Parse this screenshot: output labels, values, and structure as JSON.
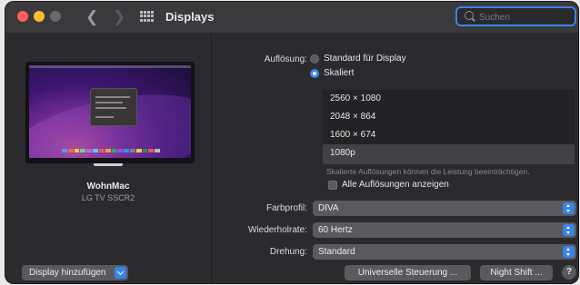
{
  "window": {
    "title": "Displays"
  },
  "search": {
    "placeholder": "Suchen",
    "value": ""
  },
  "display": {
    "name": "WohnMac",
    "model": "LG TV SSCR2"
  },
  "add_display": {
    "label": "Display hinzufügen"
  },
  "resolution": {
    "label": "Auflösung:",
    "option_default": "Standard für Display",
    "option_scaled": "Skaliert",
    "selected": "Skaliert",
    "list": [
      "2560 × 1080",
      "2048 × 864",
      "1600 × 674",
      "1080p"
    ],
    "selected_item": "1080p",
    "hint": "Skalierte Auflösungen können die Leistung beeinträchtigen.",
    "show_all_label": "Alle Auflösungen anzeigen",
    "show_all_checked": false
  },
  "color_profile": {
    "label": "Farbprofil:",
    "value": "DIVA"
  },
  "refresh_rate": {
    "label": "Wiederholrate:",
    "value": "60 Hertz"
  },
  "rotation": {
    "label": "Drehung:",
    "value": "Standard"
  },
  "buttons": {
    "universal_control": "Universelle Steuerung ...",
    "night_shift": "Night Shift ...",
    "help": "?"
  },
  "colors": {
    "accent": "#3a84e8",
    "window_bg": "#2b2b2e",
    "titlebar_bg": "#3a3a3d"
  },
  "icons": {
    "back": "chevron-left-icon",
    "forward": "chevron-right-icon",
    "grid": "grid-icon",
    "search": "search-icon"
  }
}
